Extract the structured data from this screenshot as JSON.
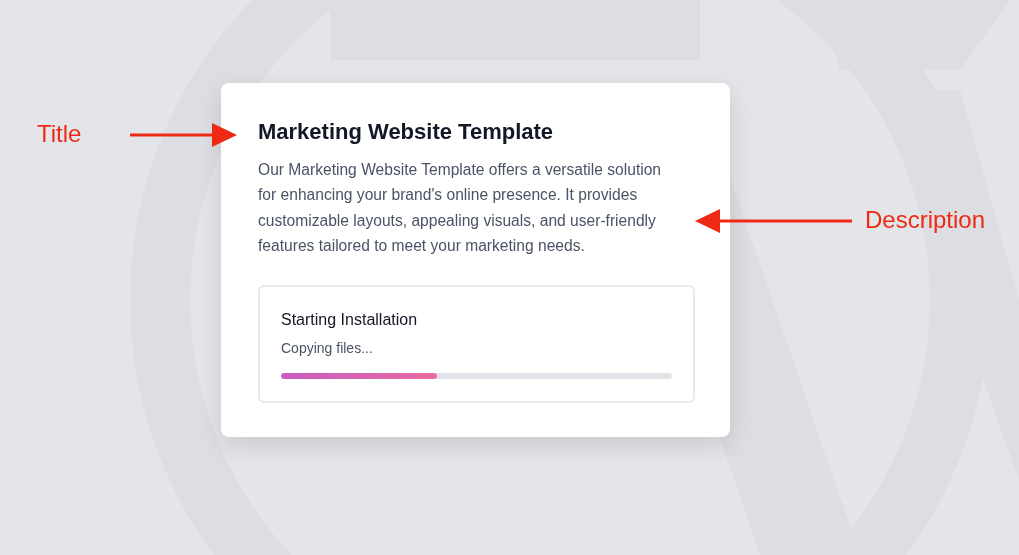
{
  "card": {
    "title": "Marketing Website Template",
    "description": "Our Marketing Website Template offers a versatile solution for enhancing your brand's online presence. It provides customizable layouts, appealing visuals, and user-friendly features tailored to meet your marketing needs."
  },
  "progress": {
    "title": "Starting Installation",
    "status": "Copying files...",
    "level": 0.4
  },
  "annotations": {
    "title_label": "Title",
    "description_label": "Description"
  }
}
